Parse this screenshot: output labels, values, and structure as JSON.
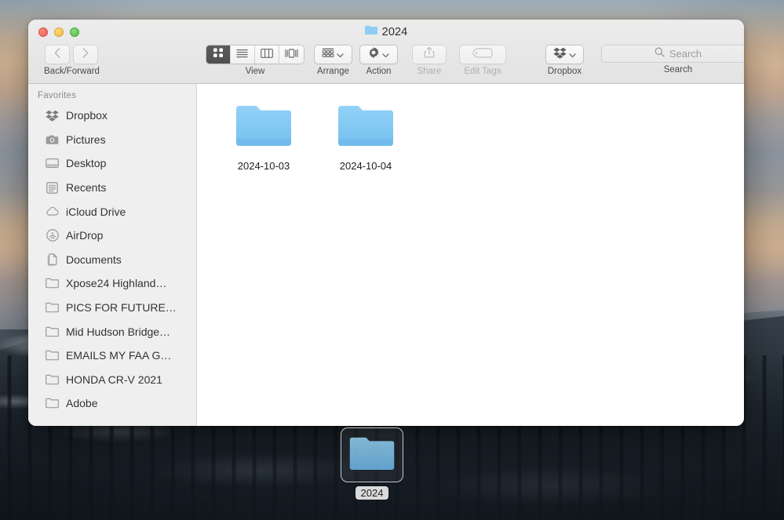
{
  "window": {
    "title": "2024",
    "title_icon": "folder-icon",
    "traffic_lights": [
      {
        "name": "close-button",
        "color": "#ed6a5f"
      },
      {
        "name": "minimize-button",
        "color": "#f5bf4f"
      },
      {
        "name": "maximize-button",
        "color": "#61c555"
      }
    ]
  },
  "toolbar": {
    "nav": {
      "caption": "Back/Forward",
      "back_icon": "chevron-left-icon",
      "forward_icon": "chevron-right-icon"
    },
    "view": {
      "caption": "View",
      "options": [
        {
          "name": "icon-view",
          "icon": "grid-icon",
          "selected": true
        },
        {
          "name": "list-view",
          "icon": "list-icon",
          "selected": false
        },
        {
          "name": "column-view",
          "icon": "columns-icon",
          "selected": false
        },
        {
          "name": "gallery-view",
          "icon": "gallery-icon",
          "selected": false
        }
      ]
    },
    "arrange": {
      "caption": "Arrange",
      "icon": "arrange-grid-icon",
      "enabled": true
    },
    "action": {
      "caption": "Action",
      "icon": "gear-icon",
      "enabled": true
    },
    "share": {
      "caption": "Share",
      "icon": "share-icon",
      "enabled": false
    },
    "edit_tags": {
      "caption": "Edit Tags",
      "icon": "tag-icon",
      "enabled": false
    },
    "dropbox": {
      "caption": "Dropbox",
      "icon": "dropbox-icon",
      "enabled": true
    },
    "search": {
      "caption": "Search",
      "placeholder": "Search",
      "value": "",
      "icon": "search-icon"
    }
  },
  "sidebar": {
    "section_title": "Favorites",
    "items": [
      {
        "label": "Dropbox",
        "icon": "dropbox-icon"
      },
      {
        "label": "Pictures",
        "icon": "camera-icon"
      },
      {
        "label": "Desktop",
        "icon": "desktop-icon"
      },
      {
        "label": "Recents",
        "icon": "recents-icon"
      },
      {
        "label": "iCloud Drive",
        "icon": "cloud-icon"
      },
      {
        "label": "AirDrop",
        "icon": "airdrop-icon"
      },
      {
        "label": "Documents",
        "icon": "documents-icon"
      },
      {
        "label": "Xpose24 Highland…",
        "icon": "folder-icon"
      },
      {
        "label": "PICS FOR FUTURE…",
        "icon": "folder-icon"
      },
      {
        "label": "Mid Hudson Bridge…",
        "icon": "folder-icon"
      },
      {
        "label": "EMAILS MY FAA G…",
        "icon": "folder-icon"
      },
      {
        "label": "HONDA CR-V 2021",
        "icon": "folder-icon"
      },
      {
        "label": "Adobe",
        "icon": "folder-icon"
      }
    ]
  },
  "content": {
    "files": [
      {
        "name": "2024-10-03",
        "icon": "folder-icon",
        "type": "folder"
      },
      {
        "name": "2024-10-04",
        "icon": "folder-icon",
        "type": "folder"
      }
    ]
  },
  "drag_ghost": {
    "label": "2024",
    "icon": "folder-icon"
  },
  "colors": {
    "folder_blue": "#7cc6f2",
    "accent_selected": "#545454",
    "window_chrome": "#e9e9e9",
    "sidebar_bg": "#efefef"
  }
}
